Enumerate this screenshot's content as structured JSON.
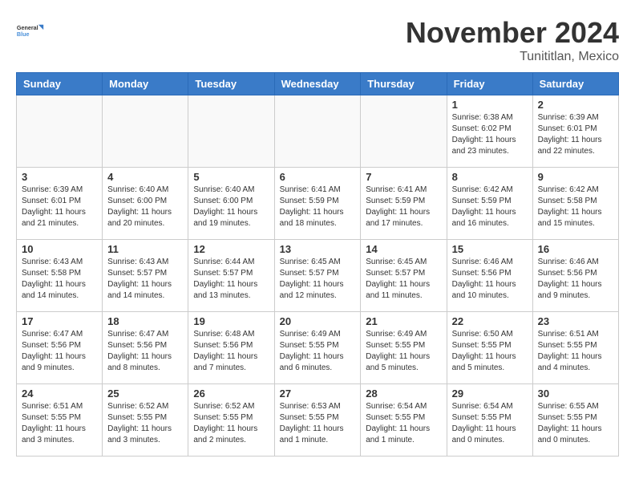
{
  "logo": {
    "line1": "General",
    "line2": "Blue"
  },
  "title": "November 2024",
  "location": "Tunititlan, Mexico",
  "days_header": [
    "Sunday",
    "Monday",
    "Tuesday",
    "Wednesday",
    "Thursday",
    "Friday",
    "Saturday"
  ],
  "weeks": [
    [
      {
        "day": "",
        "info": ""
      },
      {
        "day": "",
        "info": ""
      },
      {
        "day": "",
        "info": ""
      },
      {
        "day": "",
        "info": ""
      },
      {
        "day": "",
        "info": ""
      },
      {
        "day": "1",
        "info": "Sunrise: 6:38 AM\nSunset: 6:02 PM\nDaylight: 11 hours and 23 minutes."
      },
      {
        "day": "2",
        "info": "Sunrise: 6:39 AM\nSunset: 6:01 PM\nDaylight: 11 hours and 22 minutes."
      }
    ],
    [
      {
        "day": "3",
        "info": "Sunrise: 6:39 AM\nSunset: 6:01 PM\nDaylight: 11 hours and 21 minutes."
      },
      {
        "day": "4",
        "info": "Sunrise: 6:40 AM\nSunset: 6:00 PM\nDaylight: 11 hours and 20 minutes."
      },
      {
        "day": "5",
        "info": "Sunrise: 6:40 AM\nSunset: 6:00 PM\nDaylight: 11 hours and 19 minutes."
      },
      {
        "day": "6",
        "info": "Sunrise: 6:41 AM\nSunset: 5:59 PM\nDaylight: 11 hours and 18 minutes."
      },
      {
        "day": "7",
        "info": "Sunrise: 6:41 AM\nSunset: 5:59 PM\nDaylight: 11 hours and 17 minutes."
      },
      {
        "day": "8",
        "info": "Sunrise: 6:42 AM\nSunset: 5:59 PM\nDaylight: 11 hours and 16 minutes."
      },
      {
        "day": "9",
        "info": "Sunrise: 6:42 AM\nSunset: 5:58 PM\nDaylight: 11 hours and 15 minutes."
      }
    ],
    [
      {
        "day": "10",
        "info": "Sunrise: 6:43 AM\nSunset: 5:58 PM\nDaylight: 11 hours and 14 minutes."
      },
      {
        "day": "11",
        "info": "Sunrise: 6:43 AM\nSunset: 5:57 PM\nDaylight: 11 hours and 14 minutes."
      },
      {
        "day": "12",
        "info": "Sunrise: 6:44 AM\nSunset: 5:57 PM\nDaylight: 11 hours and 13 minutes."
      },
      {
        "day": "13",
        "info": "Sunrise: 6:45 AM\nSunset: 5:57 PM\nDaylight: 11 hours and 12 minutes."
      },
      {
        "day": "14",
        "info": "Sunrise: 6:45 AM\nSunset: 5:57 PM\nDaylight: 11 hours and 11 minutes."
      },
      {
        "day": "15",
        "info": "Sunrise: 6:46 AM\nSunset: 5:56 PM\nDaylight: 11 hours and 10 minutes."
      },
      {
        "day": "16",
        "info": "Sunrise: 6:46 AM\nSunset: 5:56 PM\nDaylight: 11 hours and 9 minutes."
      }
    ],
    [
      {
        "day": "17",
        "info": "Sunrise: 6:47 AM\nSunset: 5:56 PM\nDaylight: 11 hours and 9 minutes."
      },
      {
        "day": "18",
        "info": "Sunrise: 6:47 AM\nSunset: 5:56 PM\nDaylight: 11 hours and 8 minutes."
      },
      {
        "day": "19",
        "info": "Sunrise: 6:48 AM\nSunset: 5:56 PM\nDaylight: 11 hours and 7 minutes."
      },
      {
        "day": "20",
        "info": "Sunrise: 6:49 AM\nSunset: 5:55 PM\nDaylight: 11 hours and 6 minutes."
      },
      {
        "day": "21",
        "info": "Sunrise: 6:49 AM\nSunset: 5:55 PM\nDaylight: 11 hours and 5 minutes."
      },
      {
        "day": "22",
        "info": "Sunrise: 6:50 AM\nSunset: 5:55 PM\nDaylight: 11 hours and 5 minutes."
      },
      {
        "day": "23",
        "info": "Sunrise: 6:51 AM\nSunset: 5:55 PM\nDaylight: 11 hours and 4 minutes."
      }
    ],
    [
      {
        "day": "24",
        "info": "Sunrise: 6:51 AM\nSunset: 5:55 PM\nDaylight: 11 hours and 3 minutes."
      },
      {
        "day": "25",
        "info": "Sunrise: 6:52 AM\nSunset: 5:55 PM\nDaylight: 11 hours and 3 minutes."
      },
      {
        "day": "26",
        "info": "Sunrise: 6:52 AM\nSunset: 5:55 PM\nDaylight: 11 hours and 2 minutes."
      },
      {
        "day": "27",
        "info": "Sunrise: 6:53 AM\nSunset: 5:55 PM\nDaylight: 11 hours and 1 minute."
      },
      {
        "day": "28",
        "info": "Sunrise: 6:54 AM\nSunset: 5:55 PM\nDaylight: 11 hours and 1 minute."
      },
      {
        "day": "29",
        "info": "Sunrise: 6:54 AM\nSunset: 5:55 PM\nDaylight: 11 hours and 0 minutes."
      },
      {
        "day": "30",
        "info": "Sunrise: 6:55 AM\nSunset: 5:55 PM\nDaylight: 11 hours and 0 minutes."
      }
    ]
  ]
}
